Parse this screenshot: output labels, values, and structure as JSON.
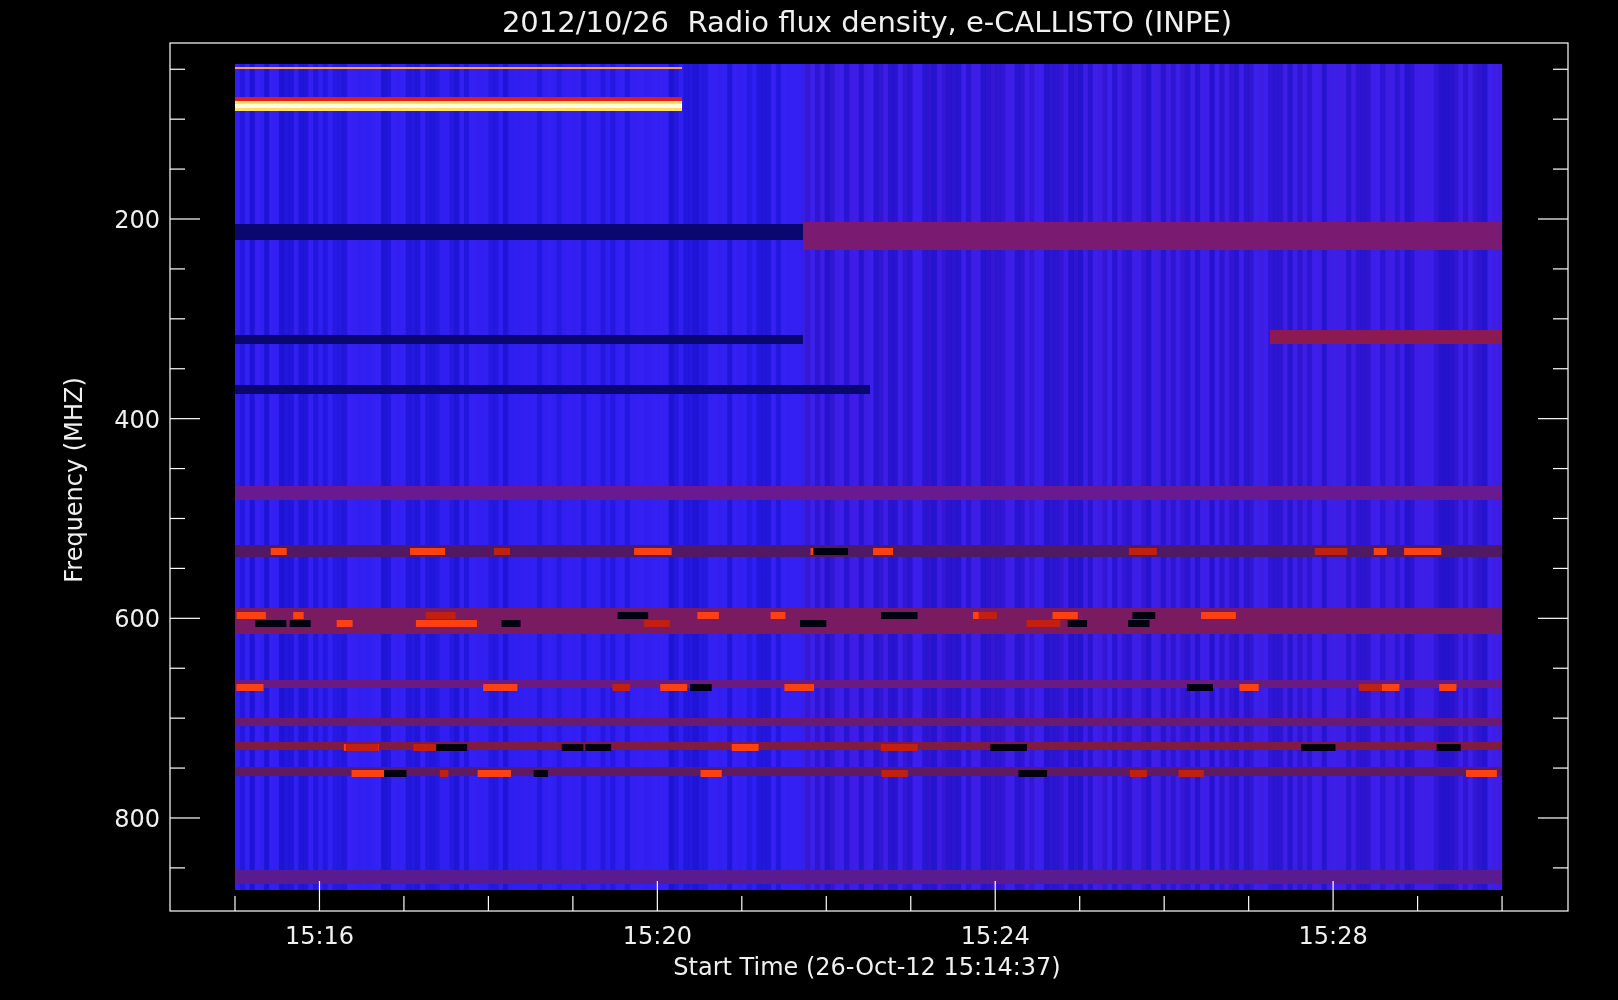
{
  "plot": {
    "title": "2012/10/26  Radio flux density, e-CALLISTO (INPE)",
    "ylabel": "Frequency (MHZ)",
    "xlabel": "Start Time (26-Oct-12 15:14:37)",
    "yticks": [
      "200",
      "400",
      "600",
      "800"
    ],
    "xticks": [
      "15:16",
      "15:20",
      "15:24",
      "15:28"
    ]
  }
}
